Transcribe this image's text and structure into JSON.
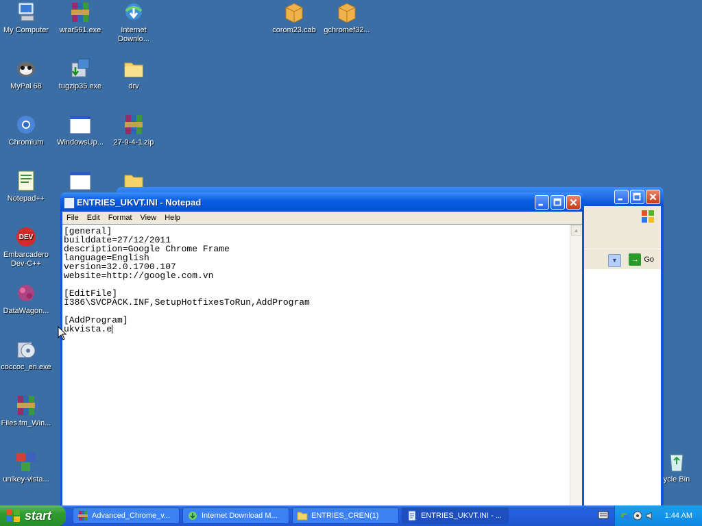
{
  "desktop": {
    "icons": [
      {
        "label": "My Computer",
        "icon": "computer-icon"
      },
      {
        "label": "wrar561.exe",
        "icon": "winrar-icon"
      },
      {
        "label": "Internet\nDownlo...",
        "icon": "idm-icon"
      },
      {
        "label": "corom23.cab",
        "icon": "cab-icon"
      },
      {
        "label": "gchromef32...",
        "icon": "cab-icon"
      },
      {
        "label": "MyPal 68",
        "icon": "mypal-icon"
      },
      {
        "label": "tugzip35.exe",
        "icon": "installer-icon"
      },
      {
        "label": "drv",
        "icon": "folder-icon"
      },
      {
        "label": "Chromium",
        "icon": "chromium-icon"
      },
      {
        "label": "WindowsUp...",
        "icon": "window-icon"
      },
      {
        "label": "27-9-4-1.zip",
        "icon": "winrar-icon"
      },
      {
        "label": "Notepad++",
        "icon": "notepadpp-icon"
      },
      {
        "label": "Embarcadero\nDev-C++",
        "icon": "devcpp-icon"
      },
      {
        "label": "DataWagon...",
        "icon": "datawagon-icon"
      },
      {
        "label": "coccoc_en.exe",
        "icon": "installer-icon"
      },
      {
        "label": "Files.fm_Win...",
        "icon": "winrar-icon"
      },
      {
        "label": "unikey-vista...",
        "icon": "unikey-icon"
      },
      {
        "label": "ycle Bin",
        "icon": "recycle-bin-icon"
      }
    ]
  },
  "background_window": {
    "go_label": "Go"
  },
  "notepad": {
    "title": "ENTRIES_UKVT.INI - Notepad",
    "menu": [
      "File",
      "Edit",
      "Format",
      "View",
      "Help"
    ],
    "content": "[general]\nbuilddate=27/12/2011\ndescription=Google Chrome Frame\nlanguage=English\nversion=32.0.1700.107\nwebsite=http://google.com.vn\n\n[EditFile]\nI386\\SVCPACK.INF,SetupHotfixesToRun,AddProgram\n\n[AddProgram]\nukvista.e"
  },
  "taskbar": {
    "start_label": "start",
    "tasks": [
      {
        "label": "Advanced_Chrome_v...",
        "icon": "winrar-icon"
      },
      {
        "label": "Internet Download M...",
        "icon": "idm-icon"
      },
      {
        "label": "ENTRIES_CREN(1)",
        "icon": "folder-icon"
      },
      {
        "label": "ENTRIES_UKVT.INI - ...",
        "icon": "notepad-icon"
      }
    ],
    "clock": "1:44 AM"
  },
  "colors": {
    "desktop": "#3a6ea5",
    "xp_blue": "#0a58d8",
    "start_green": "#2f9b2f"
  }
}
